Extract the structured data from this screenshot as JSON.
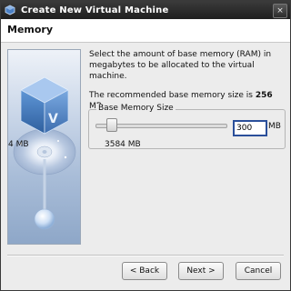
{
  "window": {
    "title": "Create New Virtual Machine",
    "close_symbol": "×"
  },
  "page": {
    "heading": "Memory"
  },
  "content": {
    "description": "Select the amount of base memory (RAM) in megabytes to be allocated to the virtual machine.",
    "recommended_prefix": "The recommended base memory size is ",
    "recommended_value": "256",
    "recommended_suffix": " MB."
  },
  "memory": {
    "group_label": "Base Memory Size",
    "value": "300",
    "unit": "MB",
    "min_label": "4 MB",
    "max_label": "3584 MB",
    "min_mb": 4,
    "max_mb": 3584
  },
  "buttons": {
    "back": "< Back",
    "next": "Next >",
    "cancel": "Cancel"
  },
  "colors": {
    "titlebar": "#2b2b2b",
    "input_focus_border": "#2a4f9a",
    "dialog_bg": "#ececec"
  },
  "icons": {
    "title": "virtualbox-icon",
    "close": "close-icon",
    "sidebar": "virtualbox-cube-disc-illustration"
  }
}
